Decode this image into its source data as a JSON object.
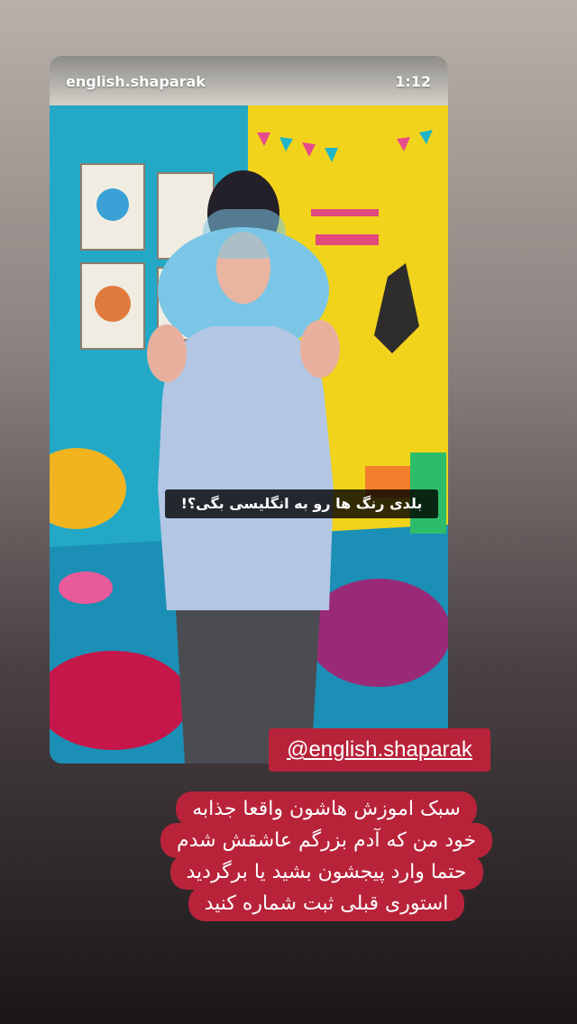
{
  "story": {
    "account": "english.shaparak",
    "time": "1:12",
    "caption": "بلدی رنگ ها رو به انگلیسی بگی؟!"
  },
  "mention": "@english.shaparak",
  "comment_lines": [
    "سبک اموزش هاشون واقعا جذابه",
    "خود من که آدم بزرگم عاشقش شدم",
    "حتما وارد پیجشون بشید یا برگردید",
    "استوری قبلی ثبت شماره کنید"
  ]
}
